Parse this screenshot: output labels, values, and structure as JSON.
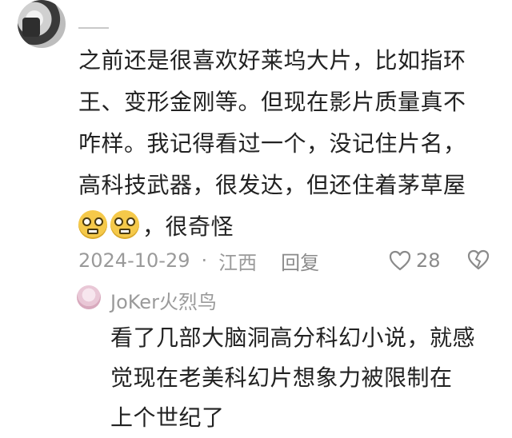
{
  "comment": {
    "lines": [
      "之前还是很喜欢好莱坞大片，比如指环",
      "王、变形金刚等。但现在影片质量真不",
      "咋样。我记得看过一个，没记住片名，",
      "高科技武器，很发达，但还住着茅草屋"
    ],
    "last_line_text": "，很奇怪",
    "date": "2024-10-29",
    "separator": "·",
    "location": "江西",
    "reply_label": "回复",
    "like_count": "28"
  },
  "reply": {
    "username": "JoKer火烈鸟",
    "lines": [
      "看了几部大脑洞高分科幻小说，就感",
      "觉现在老美科幻片想象力被限制在",
      "上个世纪了"
    ]
  },
  "icons": {
    "emoji": "grinning-emoji",
    "like": "heart-outline-icon",
    "dislike": "broken-heart-icon"
  }
}
